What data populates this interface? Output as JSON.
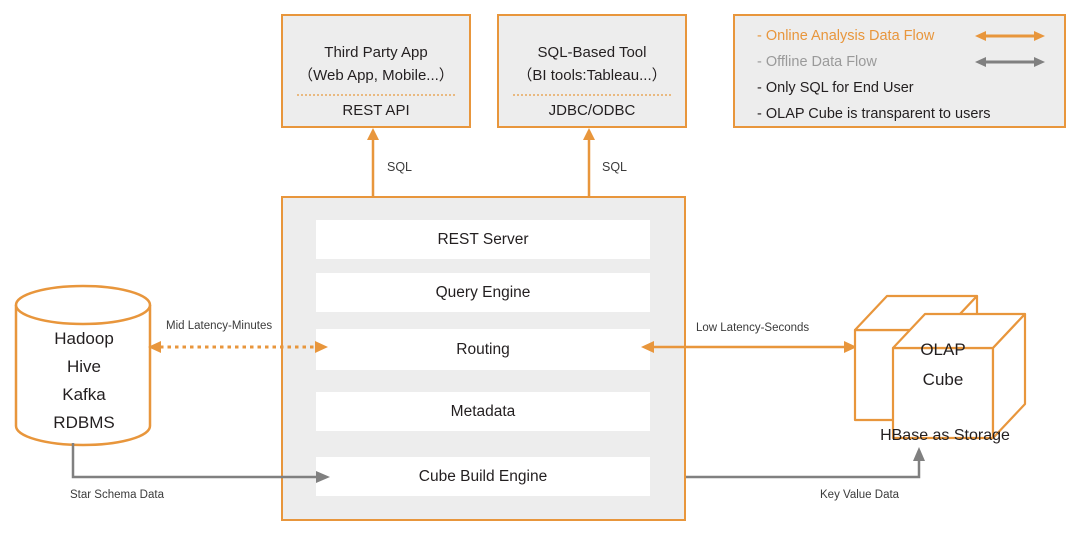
{
  "colors": {
    "orange": "#e8963c",
    "orange_dotted": "#e9b980",
    "gray_arrow": "#808080",
    "panel_fill": "#ededed",
    "box_fill": "#ffffff",
    "text": "#231f20",
    "legend_offline_text": "#9a9a9a"
  },
  "top_boxes": [
    {
      "title_line1": "Third Party App",
      "title_line2": "（Web App, Mobile...）",
      "sub": "REST API"
    },
    {
      "title_line1": "SQL-Based Tool",
      "title_line2": "（BI tools:Tableau...）",
      "sub": "JDBC/ODBC"
    }
  ],
  "legend": {
    "rows": [
      {
        "label": "- Online Analysis Data Flow",
        "arrow": "double-orange"
      },
      {
        "label": "- Offline Data Flow",
        "arrow": "double-gray"
      },
      {
        "label": "- Only SQL for End User",
        "arrow": "none"
      },
      {
        "label": "- OLAP Cube is transparent to users",
        "arrow": "none"
      }
    ]
  },
  "panel": {
    "layers": [
      "REST Server",
      "Query Engine",
      "Routing",
      "Metadata",
      "Cube Build Engine"
    ]
  },
  "datasource": {
    "lines": [
      "Hadoop",
      "Hive",
      "Kafka",
      "RDBMS"
    ]
  },
  "cube": {
    "lines": [
      "OLAP",
      "Cube"
    ],
    "storage_label": "HBase  as Storage"
  },
  "connectors": {
    "sql_left": "SQL",
    "sql_right": "SQL",
    "mid_latency": "Mid Latency-Minutes",
    "low_latency": "Low Latency-Seconds",
    "star_schema": "Star Schema Data",
    "key_value": "Key Value Data"
  }
}
